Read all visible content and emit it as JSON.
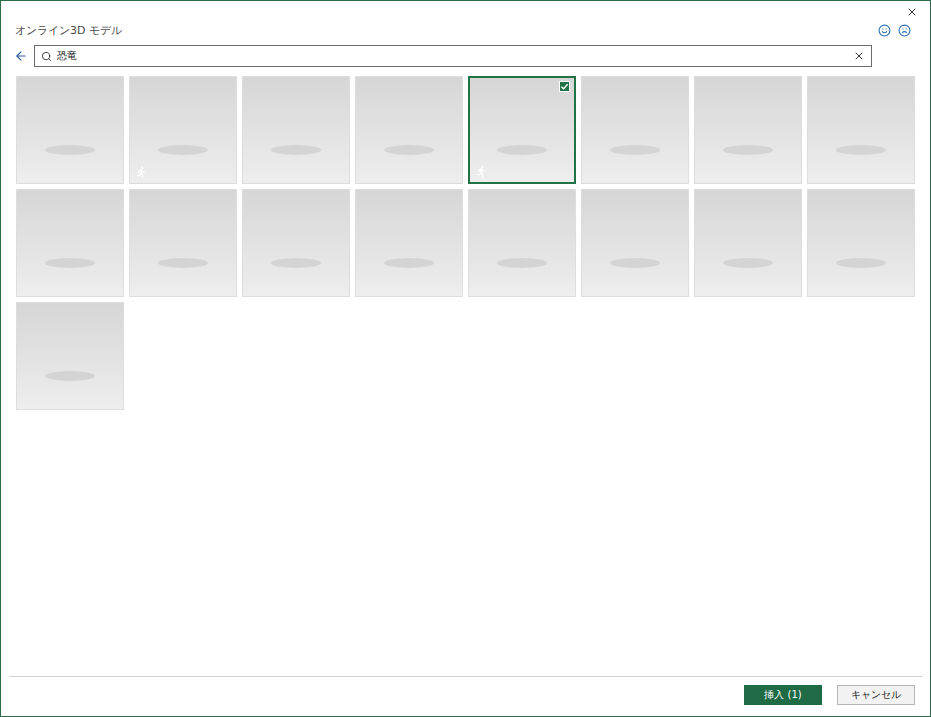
{
  "window": {
    "title": "オンライン3D モデル"
  },
  "search": {
    "value": "恐竜"
  },
  "results": [
    {
      "selected": false,
      "animated": false
    },
    {
      "selected": false,
      "animated": true
    },
    {
      "selected": false,
      "animated": false
    },
    {
      "selected": false,
      "animated": false
    },
    {
      "selected": true,
      "animated": true
    },
    {
      "selected": false,
      "animated": false
    },
    {
      "selected": false,
      "animated": false
    },
    {
      "selected": false,
      "animated": false
    },
    {
      "selected": false,
      "animated": false
    },
    {
      "selected": false,
      "animated": false
    },
    {
      "selected": false,
      "animated": false
    },
    {
      "selected": false,
      "animated": false
    },
    {
      "selected": false,
      "animated": false
    },
    {
      "selected": false,
      "animated": false
    },
    {
      "selected": false,
      "animated": false
    },
    {
      "selected": false,
      "animated": false
    },
    {
      "selected": false,
      "animated": false
    }
  ],
  "buttons": [
    {
      "label": "挿入 (1)",
      "primary": true
    },
    {
      "label": "キャンセル",
      "primary": false
    }
  ]
}
